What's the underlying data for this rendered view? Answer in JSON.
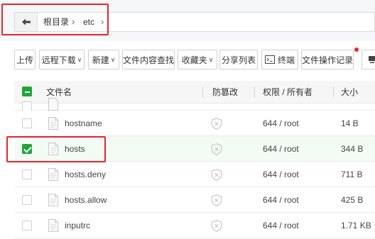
{
  "breadcrumb": {
    "root": "根目录",
    "current": "etc"
  },
  "toolbar": {
    "upload": "上传",
    "remote_download": "远程下载",
    "new": "新建",
    "search_content": "文件内容查找",
    "favorites": "收藏夹",
    "share_list": "分享列表",
    "terminal": "终端",
    "operation_log": "文件操作记录"
  },
  "table": {
    "headers": {
      "name": "文件名",
      "tamper": "防篡改",
      "perm": "权限 / 所有者",
      "size": "大小"
    },
    "rows": [
      {
        "name": "hostname",
        "perm": "644 / root",
        "size": "14 B",
        "checked": false
      },
      {
        "name": "hosts",
        "perm": "644 / root",
        "size": "344 B",
        "checked": true
      },
      {
        "name": "hosts.deny",
        "perm": "644 / root",
        "size": "711 B",
        "checked": false
      },
      {
        "name": "hosts.allow",
        "perm": "644 / root",
        "size": "425 B",
        "checked": false
      },
      {
        "name": "inputrc",
        "perm": "644 / root",
        "size": "1.71 KB",
        "checked": false
      }
    ]
  },
  "colors": {
    "accent_green": "#20a53a",
    "highlight_red": "#e3262e"
  }
}
